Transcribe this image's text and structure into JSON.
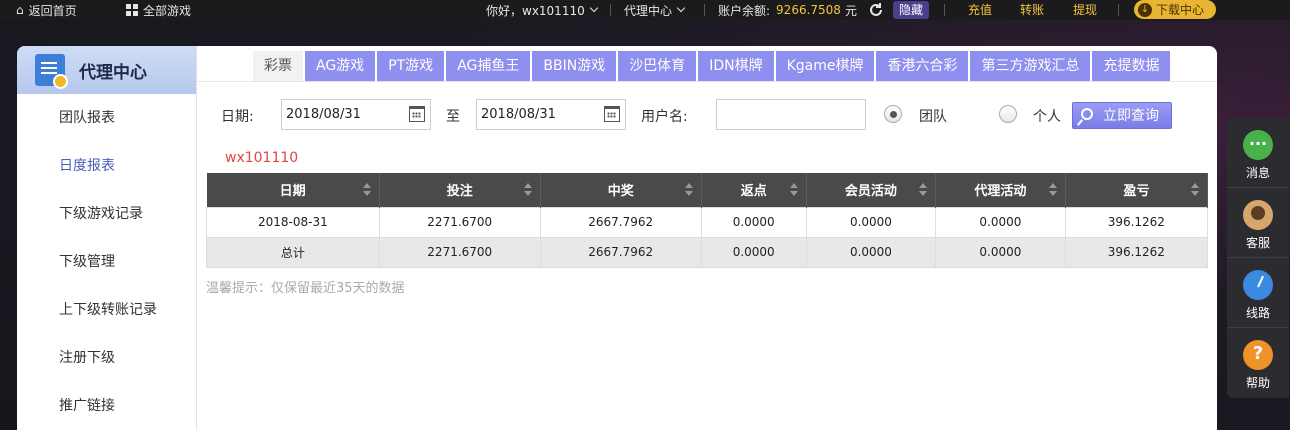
{
  "topbar": {
    "home": "返回首页",
    "all_games": "全部游戏",
    "greeting": "你好，wx101110",
    "agent_center": "代理中心",
    "balance_label": "账户余额:",
    "balance_amount": "9266.7508",
    "balance_unit": "元",
    "hide": "隐藏",
    "recharge": "充值",
    "transfer": "转账",
    "withdraw": "提现",
    "download": "下载中心"
  },
  "sidebar": {
    "title": "代理中心",
    "items": [
      {
        "label": "团队报表"
      },
      {
        "label": "日度报表"
      },
      {
        "label": "下级游戏记录"
      },
      {
        "label": "下级管理"
      },
      {
        "label": "上下级转账记录"
      },
      {
        "label": "注册下级"
      },
      {
        "label": "推广链接"
      }
    ]
  },
  "tabs": [
    "彩票",
    "AG游戏",
    "PT游戏",
    "AG捕鱼王",
    "BBIN游戏",
    "沙巴体育",
    "IDN棋牌",
    "Kgame棋牌",
    "香港六合彩",
    "第三方游戏汇总",
    "充提数据"
  ],
  "filter": {
    "date_label": "日期:",
    "start_date": "2018/08/31",
    "to_label": "至",
    "end_date": "2018/08/31",
    "username_label": "用户名:",
    "username_value": "",
    "team_label": "团队",
    "personal_label": "个人",
    "query_label": "立即查询"
  },
  "username_display": "wx101110",
  "table": {
    "headers": [
      "日期",
      "投注",
      "中奖",
      "返点",
      "会员活动",
      "代理活动",
      "盈亏"
    ],
    "rows": [
      [
        "2018-08-31",
        "2271.6700",
        "2667.7962",
        "0.0000",
        "0.0000",
        "0.0000",
        "396.1262"
      ]
    ],
    "total": [
      "总计",
      "2271.6700",
      "2667.7962",
      "0.0000",
      "0.0000",
      "0.0000",
      "396.1262"
    ]
  },
  "tip": "温馨提示：仅保留最近35天的数据",
  "float_menu": {
    "message": "消息",
    "service": "客服",
    "line": "线路",
    "help": "帮助"
  }
}
